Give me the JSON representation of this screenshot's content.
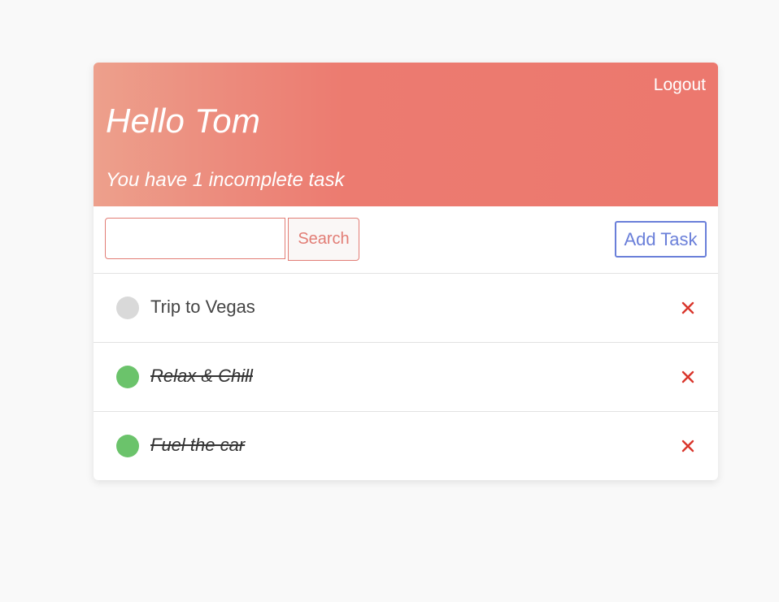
{
  "header": {
    "logout_label": "Logout",
    "greeting": "Hello Tom",
    "subtitle": "You have 1 incomplete task",
    "gradient_colors": [
      "#eda08c",
      "#ec786e"
    ]
  },
  "toolbar": {
    "search_value": "",
    "search_placeholder": "",
    "search_label": "Search",
    "add_label": "Add Task"
  },
  "tasks": [
    {
      "label": "Trip to Vegas",
      "completed": false,
      "delete_icon": "close-icon"
    },
    {
      "label": "Relax & Chill",
      "completed": true,
      "delete_icon": "close-icon"
    },
    {
      "label": "Fuel the car",
      "completed": true,
      "delete_icon": "close-icon"
    }
  ],
  "colors": {
    "accent": "#e27d75",
    "add_button": "#6a7fd9",
    "complete": "#6bc36b",
    "incomplete": "#d9d9d9",
    "delete": "#d9352b"
  }
}
